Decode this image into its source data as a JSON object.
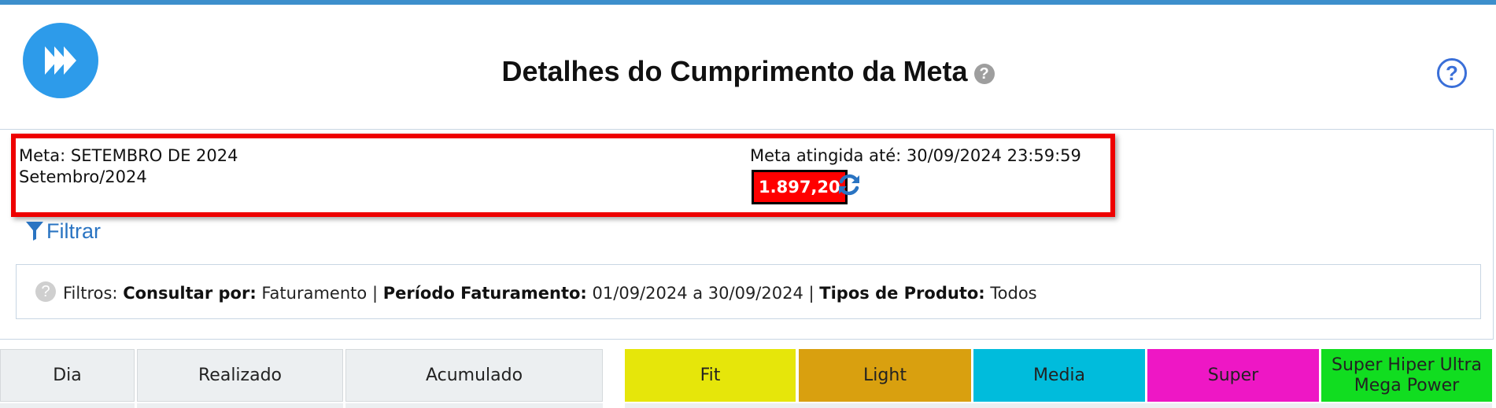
{
  "header": {
    "title": "Detalhes do Cumprimento da Meta",
    "title_help": "?",
    "help": "?"
  },
  "meta": {
    "name": "Meta: SETEMBRO DE 2024",
    "period": "Setembro/2024",
    "until": "Meta atingida até: 30/09/2024 23:59:59",
    "value": "1.897,20"
  },
  "filter": {
    "link_label": "Filtrar",
    "help": "?",
    "prefix": "Filtros:",
    "consult_label": "Consultar por:",
    "consult_value": "Faturamento",
    "period_label": "Período Faturamento:",
    "period_value": "01/09/2024 a 30/09/2024",
    "types_label": "Tipos de Produto:",
    "types_value": "Todos",
    "separator": "|"
  },
  "table": {
    "columns": [
      "Dia",
      "Realizado",
      "Acumulado"
    ],
    "levels": [
      {
        "label": "Fit",
        "color": "#e6e60a"
      },
      {
        "label": "Light",
        "color": "#d9a00f"
      },
      {
        "label": "Media",
        "color": "#00bcdc"
      },
      {
        "label": "Super",
        "color": "#ee17c5"
      },
      {
        "label": "Super Hiper Ultra Mega Power",
        "color": "#11dd20"
      }
    ]
  },
  "colors": {
    "accent": "#3d8fcc",
    "logo": "#2d9bea",
    "link": "#2a74c2",
    "highlight_border": "#ee0000",
    "value_background": "#ff0000"
  }
}
